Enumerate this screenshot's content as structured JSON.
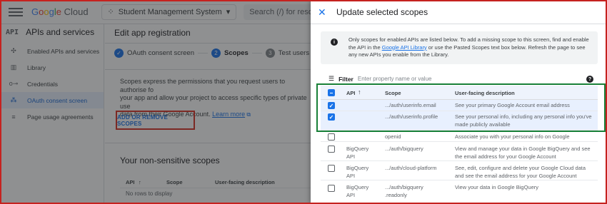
{
  "topbar": {
    "logo": "Google Cloud",
    "project": "Student Management System",
    "search_placeholder": "Search (/) for resources, docs, product"
  },
  "sidebar": {
    "api_icon": "API",
    "title": "APIs and services",
    "items": [
      {
        "label": "Enabled APIs and services",
        "icon": "diamond-icon"
      },
      {
        "label": "Library",
        "icon": "library-icon"
      },
      {
        "label": "Credentials",
        "icon": "key-icon"
      },
      {
        "label": "OAuth consent screen",
        "icon": "consent-icon"
      },
      {
        "label": "Page usage agreements",
        "icon": "settings-list-icon"
      }
    ]
  },
  "main": {
    "title": "Edit app registration",
    "steps": [
      {
        "label": "OAuth consent screen",
        "state": "done"
      },
      {
        "label": "Scopes",
        "num": "2",
        "state": "active"
      },
      {
        "label": "Test users",
        "num": "3",
        "state": "pending"
      }
    ],
    "description_1": "Scopes express the permissions that you request users to authorise fo",
    "description_2": "your app and allow your project to access specific types of private use",
    "description_3": "data from their Google Account.",
    "learn_more": "Learn more",
    "add_button": "ADD OR REMOVE SCOPES",
    "nonsensitive_title": "Your non-sensitive scopes",
    "table_headers": [
      "API",
      "Scope",
      "User-facing description"
    ],
    "empty_text": "No rows to display"
  },
  "panel": {
    "title": "Update selected scopes",
    "info_1": "Only scopes for enabled APIs are listed below. To add a missing scope to this screen, find and enable the",
    "info_2_pre": "API in the",
    "info_link": "Google API Library",
    "info_2_post": "or use the Pasted Scopes text box below. Refresh the page to see any new",
    "info_3": "APIs you enable from the Library.",
    "filter_label": "Filter",
    "filter_placeholder": "Enter property name or value",
    "headers": {
      "api": "API",
      "scope": "Scope",
      "desc": "User-facing description"
    },
    "rows": [
      {
        "api": "",
        "scope": ".../auth/userinfo.email",
        "desc": "See your primary Google Account email address",
        "checked": true
      },
      {
        "api": "",
        "scope": ".../auth/userinfo.profile",
        "desc": "See your personal info, including any personal info you've made publicly available",
        "checked": true
      },
      {
        "api": "",
        "scope": "openid",
        "desc": "Associate you with your personal info on Google",
        "checked": false
      },
      {
        "api": "BigQuery API",
        "scope": ".../auth/bigquery",
        "desc": "View and manage your data in Google BigQuery and see the email address for your Google Account",
        "checked": false
      },
      {
        "api": "BigQuery API",
        "scope": ".../auth/cloud-platform",
        "desc": "See, edit, configure and delete your Google Cloud data and see the email address for your Google Account",
        "checked": false
      },
      {
        "api": "BigQuery API",
        "scope": ".../auth/bigquery .readonly",
        "desc": "View your data in Google BigQuery",
        "checked": false
      }
    ]
  }
}
